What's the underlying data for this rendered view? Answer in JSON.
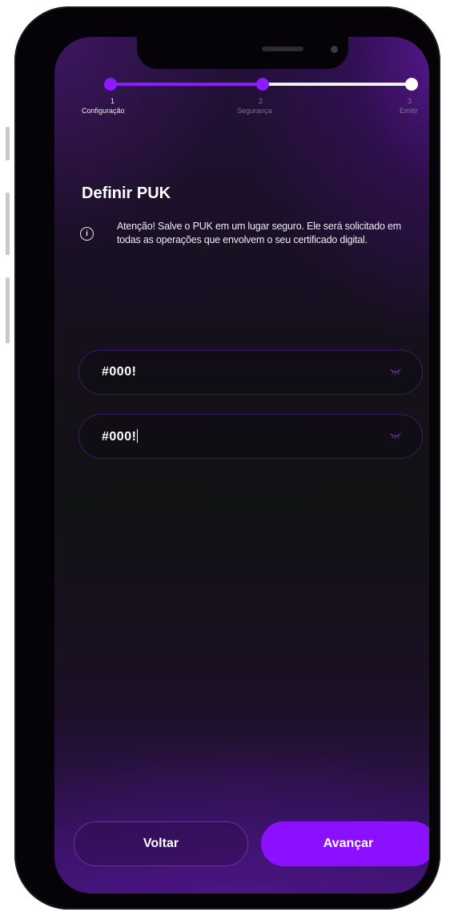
{
  "stepper": {
    "steps": [
      {
        "number": "1",
        "label": "Configuração",
        "state": "done"
      },
      {
        "number": "2",
        "label": "Segurança",
        "state": "current"
      },
      {
        "number": "3",
        "label": "Emitir",
        "state": "pending"
      }
    ]
  },
  "page": {
    "title": "Definir PUK",
    "info_text": "Atenção! Salve o PUK em um lugar seguro. Ele será solicitado em todas as operações que envolvem o seu certificado digital."
  },
  "fields": [
    {
      "value": "#000!",
      "icon": "eye-off-icon"
    },
    {
      "value": "#000!",
      "icon": "eye-off-icon",
      "focused": true
    }
  ],
  "buttons": {
    "back": "Voltar",
    "next": "Avançar"
  },
  "colors": {
    "accent": "#8a10ff",
    "inactive_track": "#f1f1f3",
    "text": "#ffffff"
  }
}
